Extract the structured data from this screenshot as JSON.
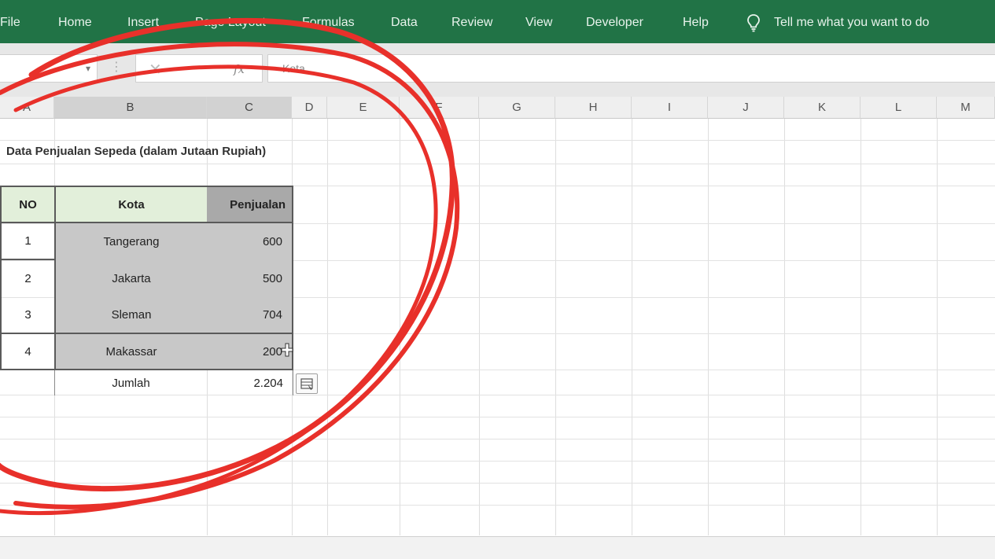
{
  "ribbon": {
    "tabs": [
      "File",
      "Home",
      "Insert",
      "Page Layout",
      "Formulas",
      "Data",
      "Review",
      "View",
      "Developer",
      "Help"
    ],
    "tell_me": "Tell me what you want to do",
    "icon": "lightbulb-icon",
    "color": "#217346"
  },
  "formula_bar": {
    "cancel_icon": "close-icon",
    "fx_label": "fx",
    "value": "Kota"
  },
  "columns": [
    "A",
    "B",
    "C",
    "D",
    "E",
    "F",
    "G",
    "H",
    "I",
    "J",
    "K",
    "L",
    "M"
  ],
  "sheet": {
    "title": "Data Penjualan Sepeda (dalam Jutaan Rupiah)",
    "headers": [
      "NO",
      "Kota",
      "Penjualan"
    ],
    "rows": [
      {
        "no": "1",
        "kota": "Tangerang",
        "penjualan": "600"
      },
      {
        "no": "2",
        "kota": "Jakarta",
        "penjualan": "500"
      },
      {
        "no": "3",
        "kota": "Sleman",
        "penjualan": "704"
      },
      {
        "no": "4",
        "kota": "Makassar",
        "penjualan": "200"
      }
    ],
    "total_label": "Jumlah",
    "total_value": "2.204"
  },
  "colors": {
    "header_green": "#e2efda",
    "selection_grey": "#c8c8c8",
    "annotation_red": "#e8302a"
  }
}
